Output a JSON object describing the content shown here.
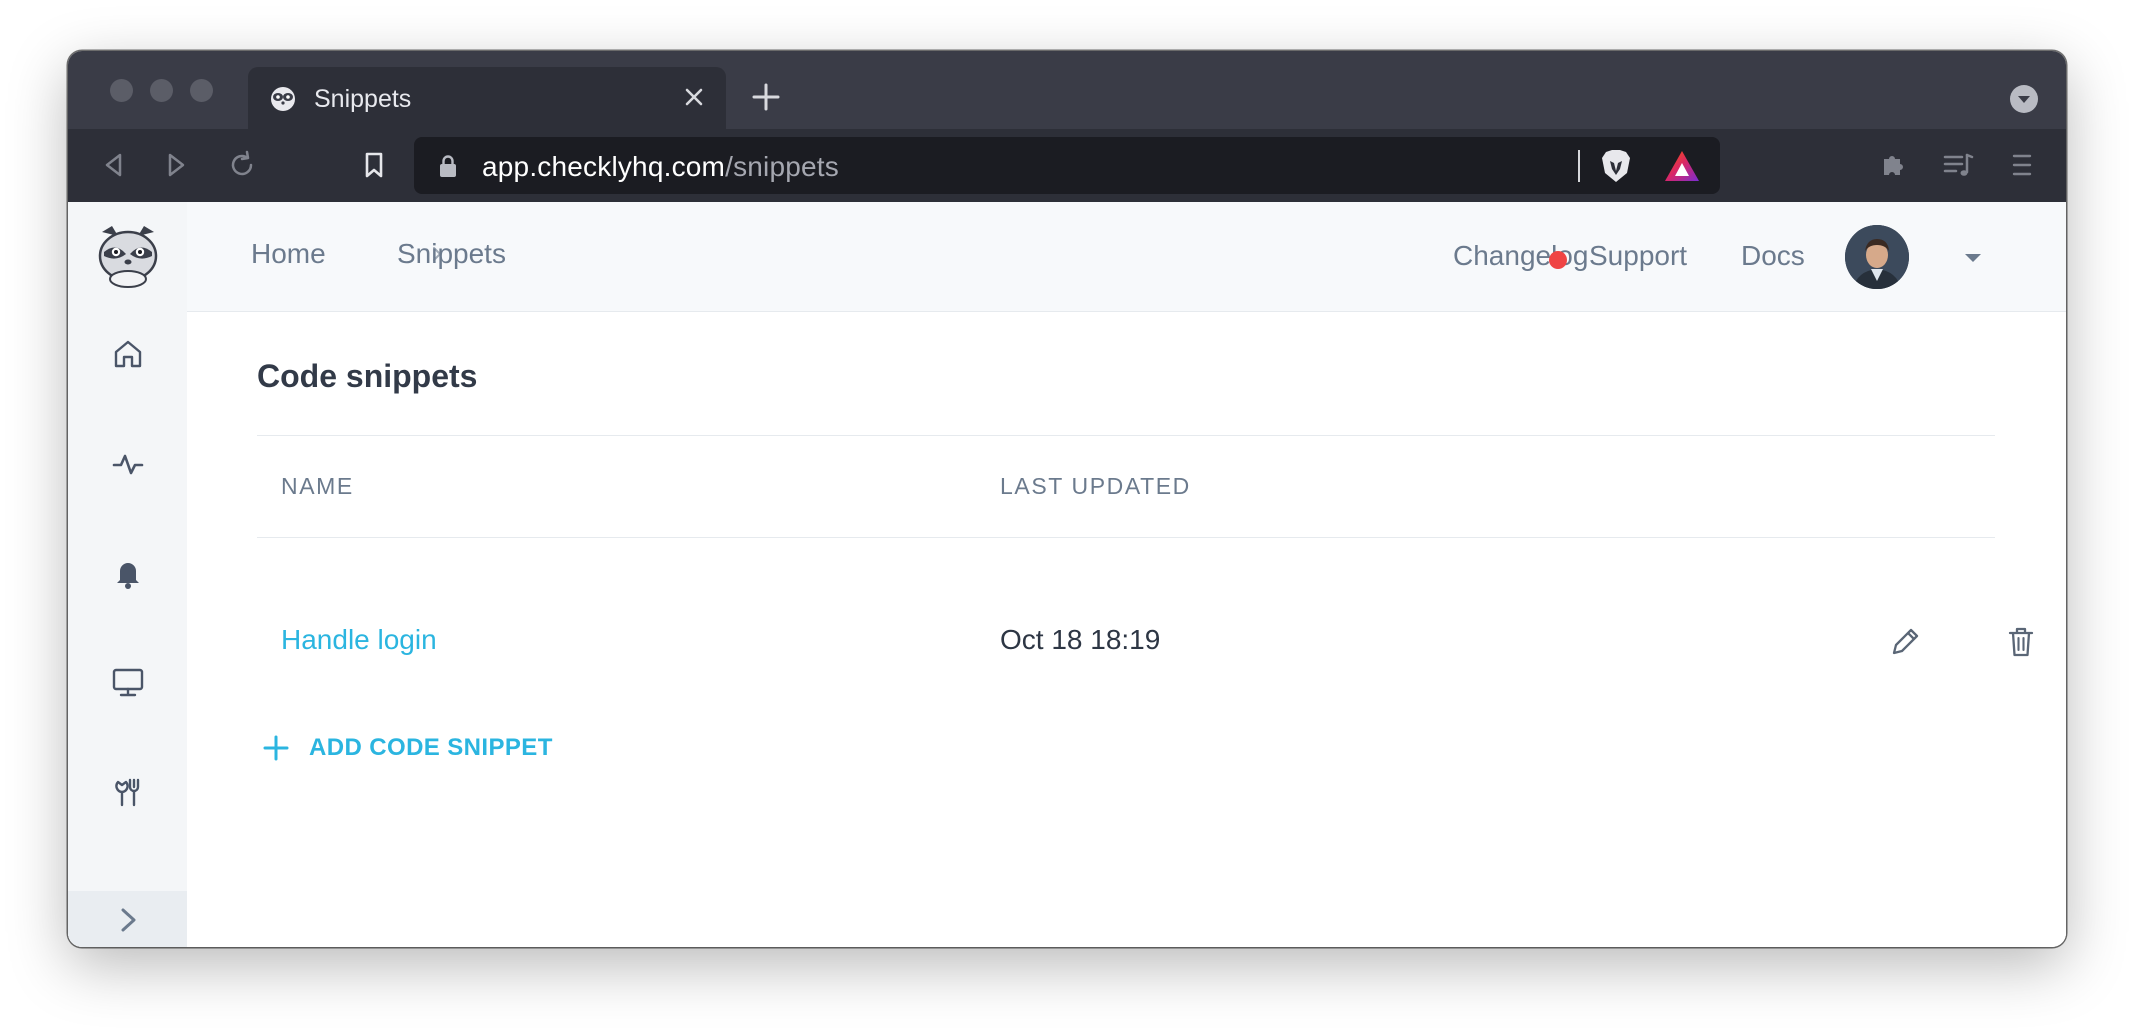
{
  "browser": {
    "tab_title": "Snippets",
    "url_host": "app.checklyhq.com",
    "url_path": "/snippets"
  },
  "breadcrumb": {
    "home": "Home",
    "current": "Snippets"
  },
  "header": {
    "changelog": "Changelog",
    "support": "Support",
    "docs": "Docs",
    "status_color": "#ef4444"
  },
  "sidebar": {
    "items": [
      {
        "icon": "home-icon"
      },
      {
        "icon": "activity-icon"
      },
      {
        "icon": "bell-icon"
      },
      {
        "icon": "monitor-icon"
      },
      {
        "icon": "tools-icon"
      }
    ],
    "toggle_icon": "chevron-right-icon"
  },
  "main": {
    "title": "Code snippets",
    "columns": [
      "NAME",
      "LAST UPDATED"
    ],
    "rows": [
      {
        "name": "Handle login",
        "last_updated": "Oct 18 18:19"
      }
    ],
    "add_button": "ADD CODE SNIPPET"
  },
  "colors": {
    "accent": "#2bb5e0",
    "text_muted": "#6b7a8d",
    "text_dark": "#323a48"
  }
}
